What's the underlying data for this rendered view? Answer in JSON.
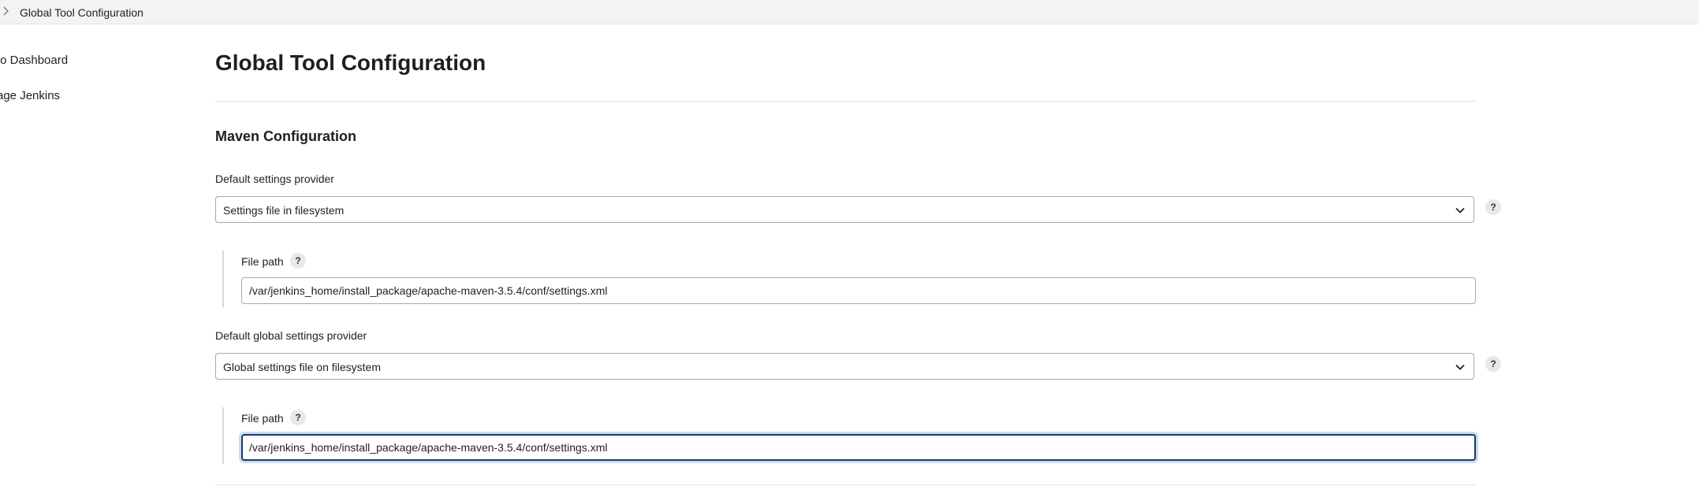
{
  "breadcrumb": {
    "current": "Global Tool Configuration"
  },
  "sidebar": {
    "items": [
      {
        "label": "to Dashboard"
      },
      {
        "label": "age Jenkins"
      }
    ]
  },
  "main": {
    "title": "Global Tool Configuration",
    "section_title": "Maven Configuration",
    "settings_provider": {
      "label": "Default settings provider",
      "selected": "Settings file in filesystem",
      "file_path_label": "File path",
      "file_path_value": "/var/jenkins_home/install_package/apache-maven-3.5.4/conf/settings.xml"
    },
    "global_settings_provider": {
      "label": "Default global settings provider",
      "selected": "Global settings file on filesystem",
      "file_path_label": "File path",
      "file_path_value": "/var/jenkins_home/install_package/apache-maven-3.5.4/conf/settings.xml"
    },
    "help_glyph": "?"
  },
  "icons": {
    "breadcrumb_separator": "chevron-right-icon",
    "dropdown": "chevron-down-icon",
    "help": "help-icon"
  }
}
